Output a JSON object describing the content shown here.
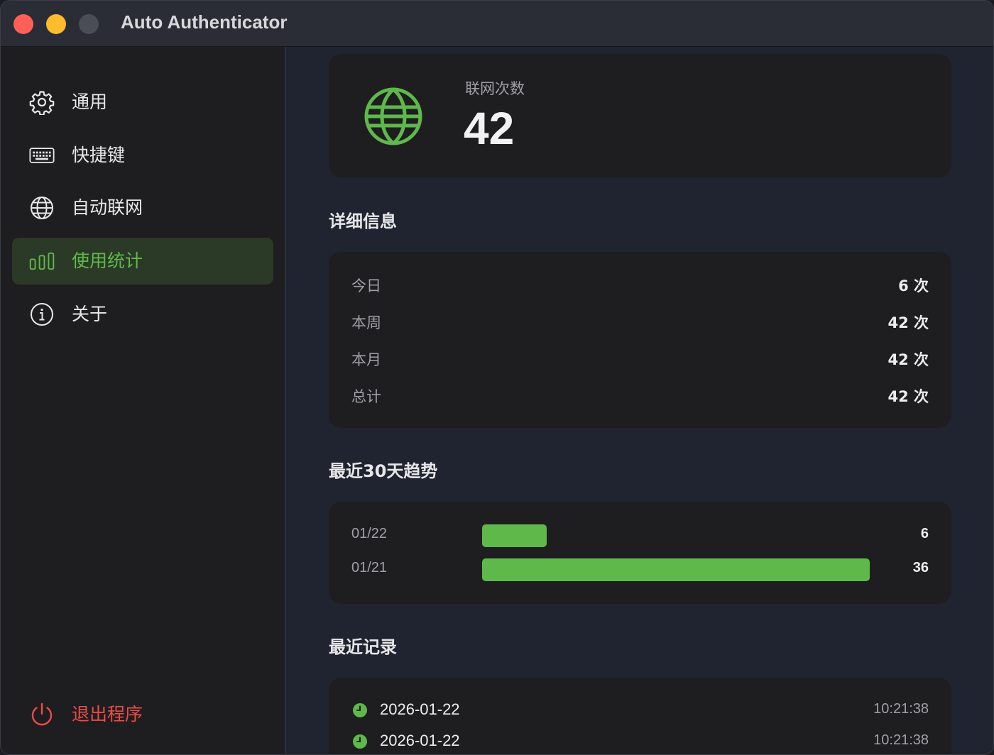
{
  "window": {
    "title": "Auto Authenticator"
  },
  "sidebar": {
    "items": [
      {
        "label": "通用",
        "icon": "gear-icon"
      },
      {
        "label": "快捷键",
        "icon": "keyboard-icon"
      },
      {
        "label": "自动联网",
        "icon": "globe-icon"
      },
      {
        "label": "使用统计",
        "icon": "bar-chart-icon",
        "active": true
      },
      {
        "label": "关于",
        "icon": "info-icon"
      }
    ],
    "quit_label": "退出程序"
  },
  "colors": {
    "accent": "#5fb94a",
    "danger": "#ee4b45",
    "card": "#1e1e20",
    "content_bg": "#1f2430"
  },
  "hero": {
    "label": "联网次数",
    "value": "42",
    "icon": "globe-icon"
  },
  "details": {
    "title": "详细信息",
    "rows": [
      {
        "label": "今日",
        "value": "6 次"
      },
      {
        "label": "本周",
        "value": "42 次"
      },
      {
        "label": "本月",
        "value": "42 次"
      },
      {
        "label": "总计",
        "value": "42 次"
      }
    ]
  },
  "trend": {
    "title": "最近30天趋势",
    "rows": [
      {
        "date": "01/22",
        "value": 6,
        "value_label": "6"
      },
      {
        "date": "01/21",
        "value": 36,
        "value_label": "36"
      }
    ]
  },
  "records": {
    "title": "最近记录",
    "rows": [
      {
        "date": "2026-01-22",
        "time": "10:21:38"
      },
      {
        "date": "2026-01-22",
        "time": "10:21:38"
      }
    ]
  }
}
